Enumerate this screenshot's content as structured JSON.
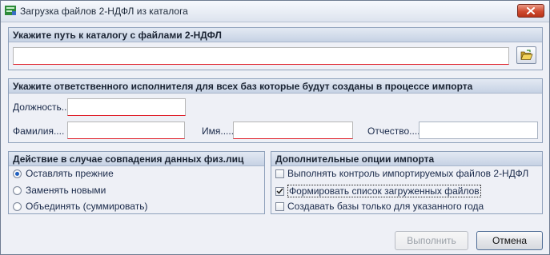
{
  "window": {
    "title": "Загрузка файлов 2-НДФЛ из каталога"
  },
  "path_group": {
    "title": "Укажите путь к каталогу с файлами 2-НДФЛ",
    "path_value": "",
    "browse_icon": "folder-open-icon"
  },
  "executor_group": {
    "title": "Укажите ответственного исполнителя для всех баз которые будут созданы в процессе импорта",
    "position_label": "Должность..",
    "position_value": "",
    "surname_label": "Фамилия....",
    "surname_value": "",
    "name_label": "Имя.....",
    "name_value": "",
    "patronymic_label": "Отчество....",
    "patronymic_value": ""
  },
  "duplicate_group": {
    "title": "Действие в случае совпадения данных физ.лиц",
    "options": [
      {
        "label": "Оставлять прежние",
        "selected": true
      },
      {
        "label": "Заменять новыми",
        "selected": false
      },
      {
        "label": "Объединять (суммировать)",
        "selected": false
      }
    ]
  },
  "import_options_group": {
    "title": "Дополнительные опции импорта",
    "options": [
      {
        "label": "Выполнять контроль импортируемых файлов 2-НДФЛ",
        "checked": false
      },
      {
        "label": "Формировать список загруженных файлов",
        "checked": true
      },
      {
        "label": "Создавать базы только для указанного года",
        "checked": false
      }
    ]
  },
  "buttons": {
    "run_label": "Выполнить",
    "cancel_label": "Отмена"
  },
  "colors": {
    "required_underline": "#e0202a",
    "close_button": "#cf4a2f",
    "group_border": "#8fa1bb"
  }
}
